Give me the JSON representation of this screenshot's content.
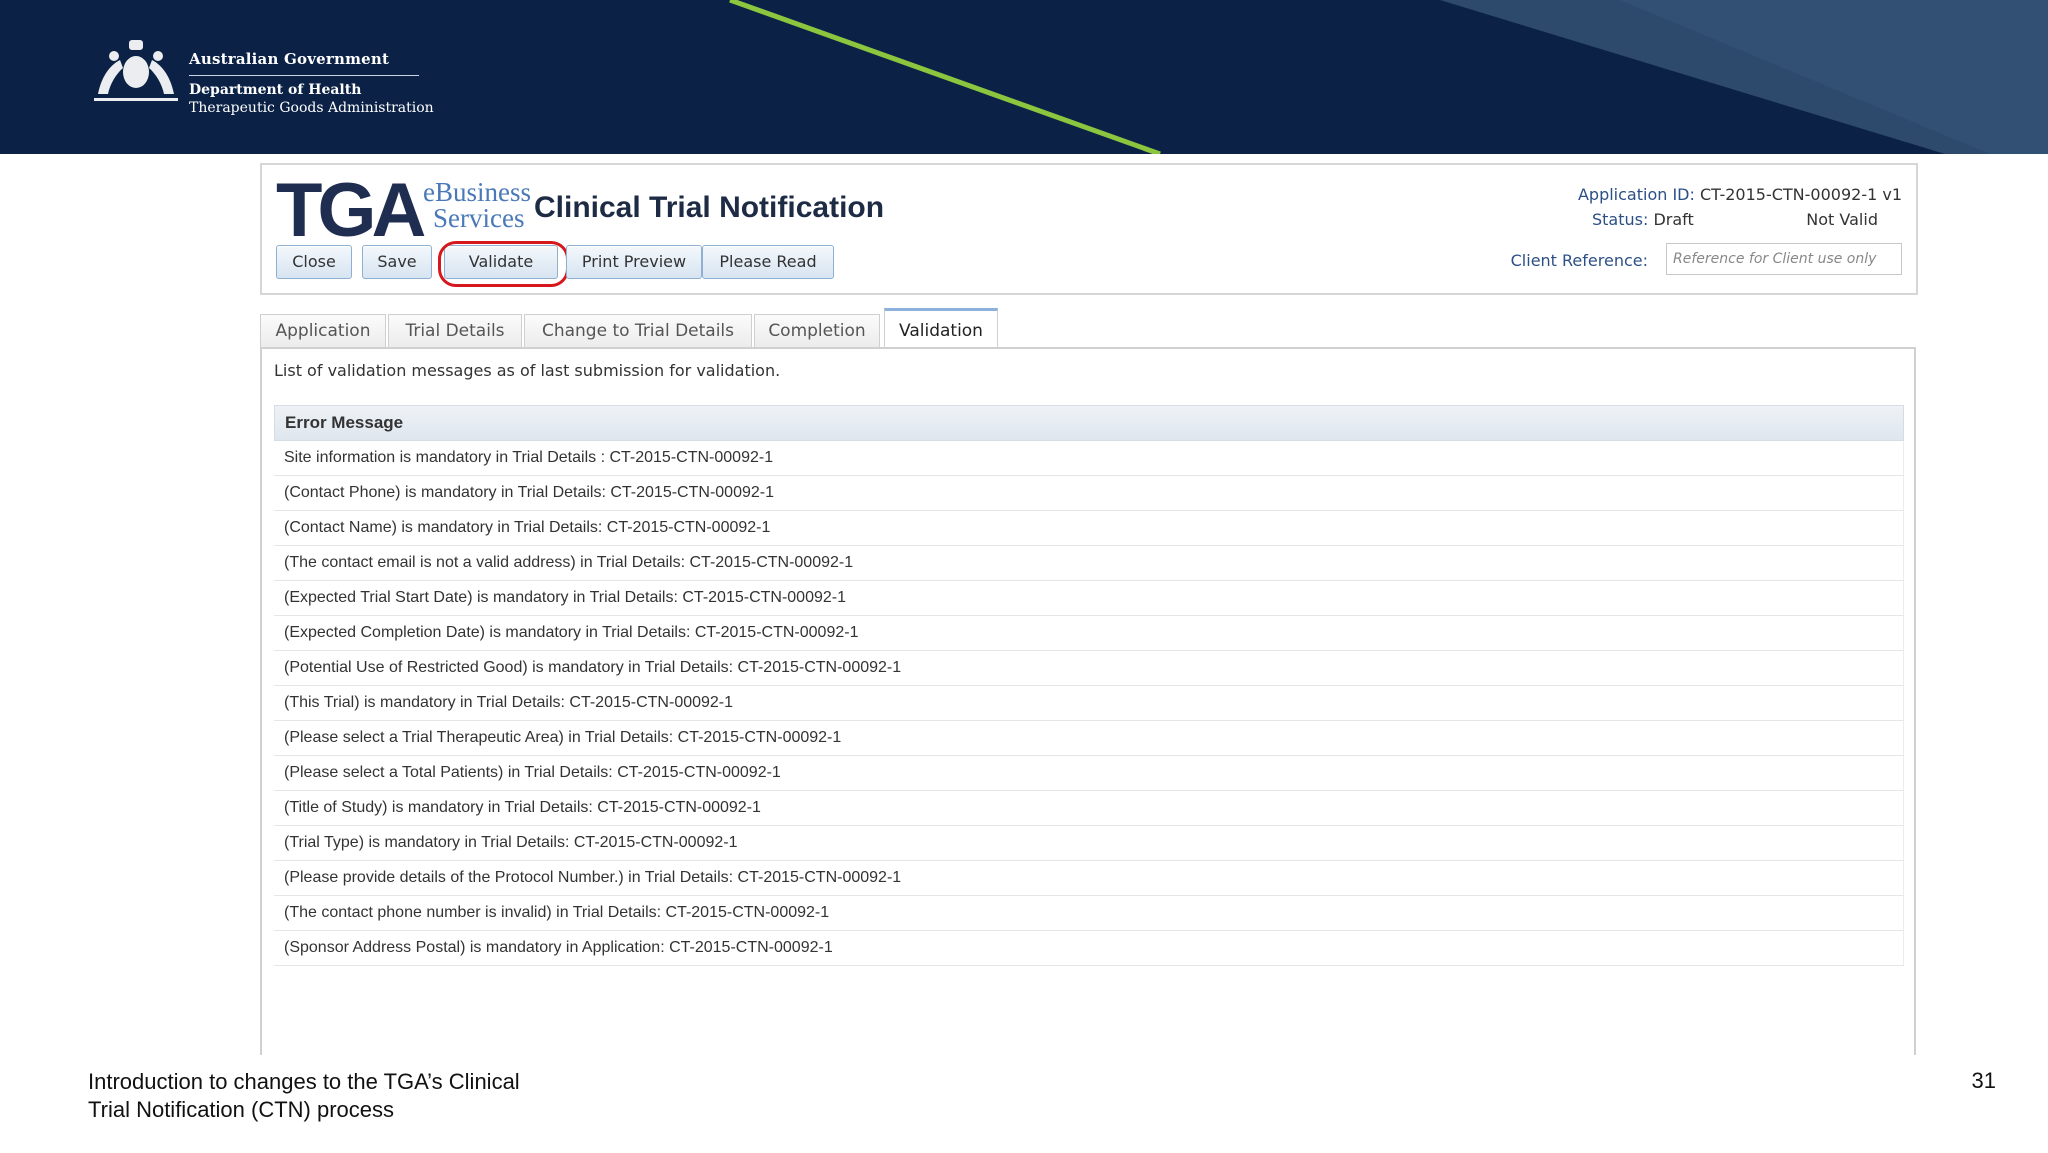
{
  "banner": {
    "government": "Australian Government",
    "department": "Department of Health",
    "agency": "Therapeutic Goods Administration"
  },
  "app": {
    "logo": "TGA",
    "logo_sub_1": "eBusiness",
    "logo_sub_2": "Services",
    "title": "Clinical Trial Notification"
  },
  "toolbar": {
    "close": "Close",
    "save": "Save",
    "validate": "Validate",
    "print_preview": "Print Preview",
    "please_read": "Please Read"
  },
  "meta": {
    "app_id_label": "Application ID:",
    "app_id_value": "CT-2015-CTN-00092-1 v1",
    "status_label": "Status:",
    "status_value": "Draft",
    "validity": "Not Valid",
    "client_ref_label": "Client Reference:",
    "client_ref_placeholder": "Reference for Client use only"
  },
  "tabs": [
    "Application",
    "Trial Details",
    "Change to Trial Details",
    "Completion",
    "Validation"
  ],
  "active_tab": "Validation",
  "validation": {
    "intro": "List of validation messages as of last submission for validation.",
    "header": "Error Message",
    "messages": [
      "Site information is mandatory in Trial Details : CT-2015-CTN-00092-1",
      "(Contact Phone) is mandatory in Trial Details: CT-2015-CTN-00092-1",
      "(Contact Name) is mandatory in Trial Details: CT-2015-CTN-00092-1",
      "(The contact email is not a valid address) in Trial Details: CT-2015-CTN-00092-1",
      "(Expected Trial Start Date) is mandatory in Trial Details: CT-2015-CTN-00092-1",
      "(Expected Completion Date) is mandatory in Trial Details: CT-2015-CTN-00092-1",
      "(Potential Use of Restricted Good) is mandatory in Trial Details: CT-2015-CTN-00092-1",
      "(This Trial) is mandatory in Trial Details: CT-2015-CTN-00092-1",
      "(Please select a Trial Therapeutic Area) in Trial Details: CT-2015-CTN-00092-1",
      "(Please select a Total Patients) in Trial Details: CT-2015-CTN-00092-1",
      "(Title of Study) is mandatory in Trial Details: CT-2015-CTN-00092-1",
      "(Trial Type) is mandatory in Trial Details: CT-2015-CTN-00092-1",
      "(Please provide details of the Protocol Number.) in Trial Details: CT-2015-CTN-00092-1",
      "(The contact phone number is invalid) in Trial Details: CT-2015-CTN-00092-1",
      "(Sponsor Address Postal) is mandatory in Application: CT-2015-CTN-00092-1"
    ]
  },
  "footer": {
    "line1": "Introduction to changes to the TGA’s Clinical",
    "line2": "Trial Notification (CTN) process",
    "page": "31"
  },
  "colors": {
    "banner": "#0b2246",
    "accent_line": "#8cc63f",
    "highlight_ring": "#d6171b"
  }
}
